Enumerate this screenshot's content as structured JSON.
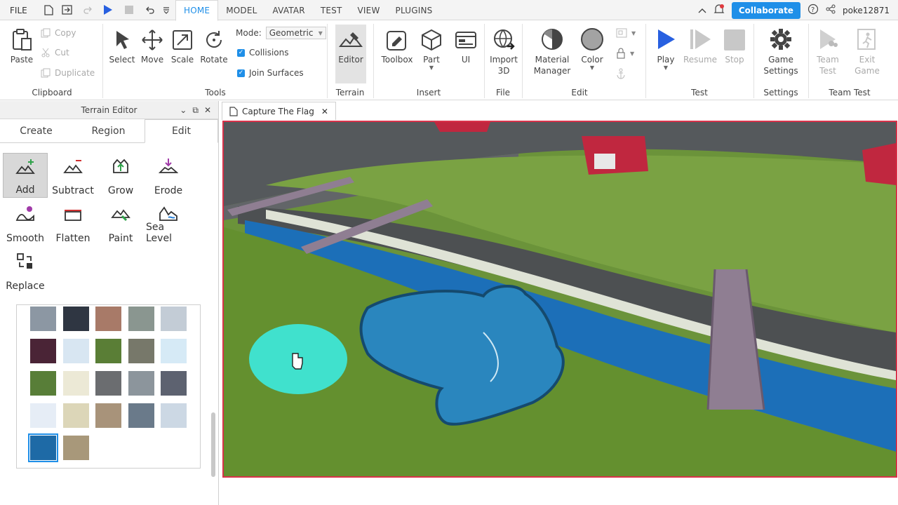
{
  "menubar": {
    "file_label": "FILE",
    "tabs": [
      "HOME",
      "MODEL",
      "AVATAR",
      "TEST",
      "VIEW",
      "PLUGINS"
    ],
    "active_tab": "HOME",
    "collaborate_label": "Collaborate",
    "username": "poke12871"
  },
  "ribbon": {
    "clipboard": {
      "paste": "Paste",
      "copy": "Copy",
      "cut": "Cut",
      "duplicate": "Duplicate",
      "label": "Clipboard"
    },
    "tools": {
      "select": "Select",
      "move": "Move",
      "scale": "Scale",
      "rotate": "Rotate",
      "mode_label": "Mode:",
      "mode_value": "Geometric",
      "collisions": "Collisions",
      "join_surfaces": "Join Surfaces",
      "label": "Tools"
    },
    "terrain": {
      "editor": "Editor",
      "label": "Terrain"
    },
    "insert": {
      "toolbox": "Toolbox",
      "part": "Part",
      "ui": "UI",
      "label": "Insert"
    },
    "file": {
      "import3d_line1": "Import",
      "import3d_line2": "3D",
      "label": "File"
    },
    "edit": {
      "material_line1": "Material",
      "material_line2": "Manager",
      "color": "Color",
      "label": "Edit"
    },
    "test": {
      "play": "Play",
      "resume": "Resume",
      "stop": "Stop",
      "label": "Test"
    },
    "settings": {
      "line1": "Game",
      "line2": "Settings",
      "label": "Settings"
    },
    "teamtest": {
      "team_line1": "Team",
      "team_line2": "Test",
      "exit_line1": "Exit",
      "exit_line2": "Game",
      "label": "Team Test"
    }
  },
  "terrain_panel": {
    "title": "Terrain Editor",
    "tabs": [
      "Create",
      "Region",
      "Edit"
    ],
    "active_tab": "Edit",
    "tools": [
      "Add",
      "Subtract",
      "Grow",
      "Erode",
      "Smooth",
      "Flatten",
      "Paint",
      "Sea Level",
      "Replace"
    ],
    "selected_tool": "Add"
  },
  "viewport": {
    "tab_label": "Capture The Flag",
    "colors": {
      "grass": "#6f9a3c",
      "water": "#1c6fb8",
      "road": "#5a5a5a",
      "brush": "#3ee6d6",
      "border": "#d9324a"
    }
  },
  "colors": {
    "accent": "#1f8fe8"
  }
}
